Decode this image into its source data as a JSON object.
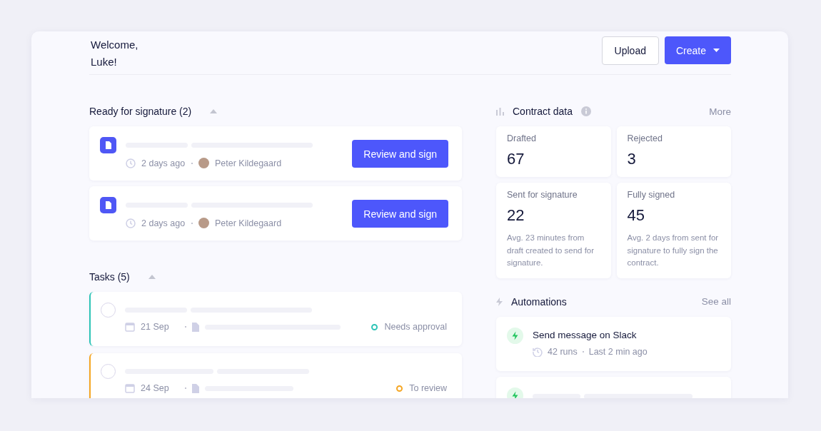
{
  "header": {
    "greeting": "Welcome, Luke!",
    "buttons": [
      {
        "label": "Upload",
        "kind": "secondary",
        "dropdown": false
      },
      {
        "label": "Create",
        "kind": "primary",
        "dropdown": true
      }
    ]
  },
  "signature": {
    "title": "Ready for signature",
    "count": "(2)",
    "expanded": true,
    "items": [
      {
        "time": "2 days ago",
        "person": "Peter Kildegaard",
        "action": "Review and sign"
      },
      {
        "time": "2 days ago",
        "person": "Peter Kildegaard",
        "action": "Review and sign"
      }
    ]
  },
  "tasks": {
    "title": "Tasks (5)",
    "expanded": true,
    "items": [
      {
        "date": "21 Sep",
        "status": "Needs approval",
        "color": "#2ec4b6",
        "checked": false
      },
      {
        "date": "24 Sep",
        "status": "To review",
        "color": "#f5a623",
        "checked": false
      }
    ]
  },
  "contract_data": {
    "title": "Contract data",
    "link": "More",
    "stats": [
      {
        "label": "Drafted",
        "value": "67"
      },
      {
        "label": "Rejected",
        "value": "3"
      },
      {
        "label": "Sent for signature",
        "value": "22",
        "note": "Avg. 23 minutes from draft created to send for signature."
      },
      {
        "label": "Fully signed",
        "value": "45",
        "note": "Avg. 2 days from sent for signature to fully sign the contract."
      }
    ]
  },
  "automations": {
    "title": "Automations",
    "link": "See all",
    "items": [
      {
        "kind": "loaded",
        "name": "Send message on Slack",
        "runs": "42 runs",
        "last": "Last 2 min ago"
      },
      {
        "kind": "loading"
      }
    ]
  }
}
